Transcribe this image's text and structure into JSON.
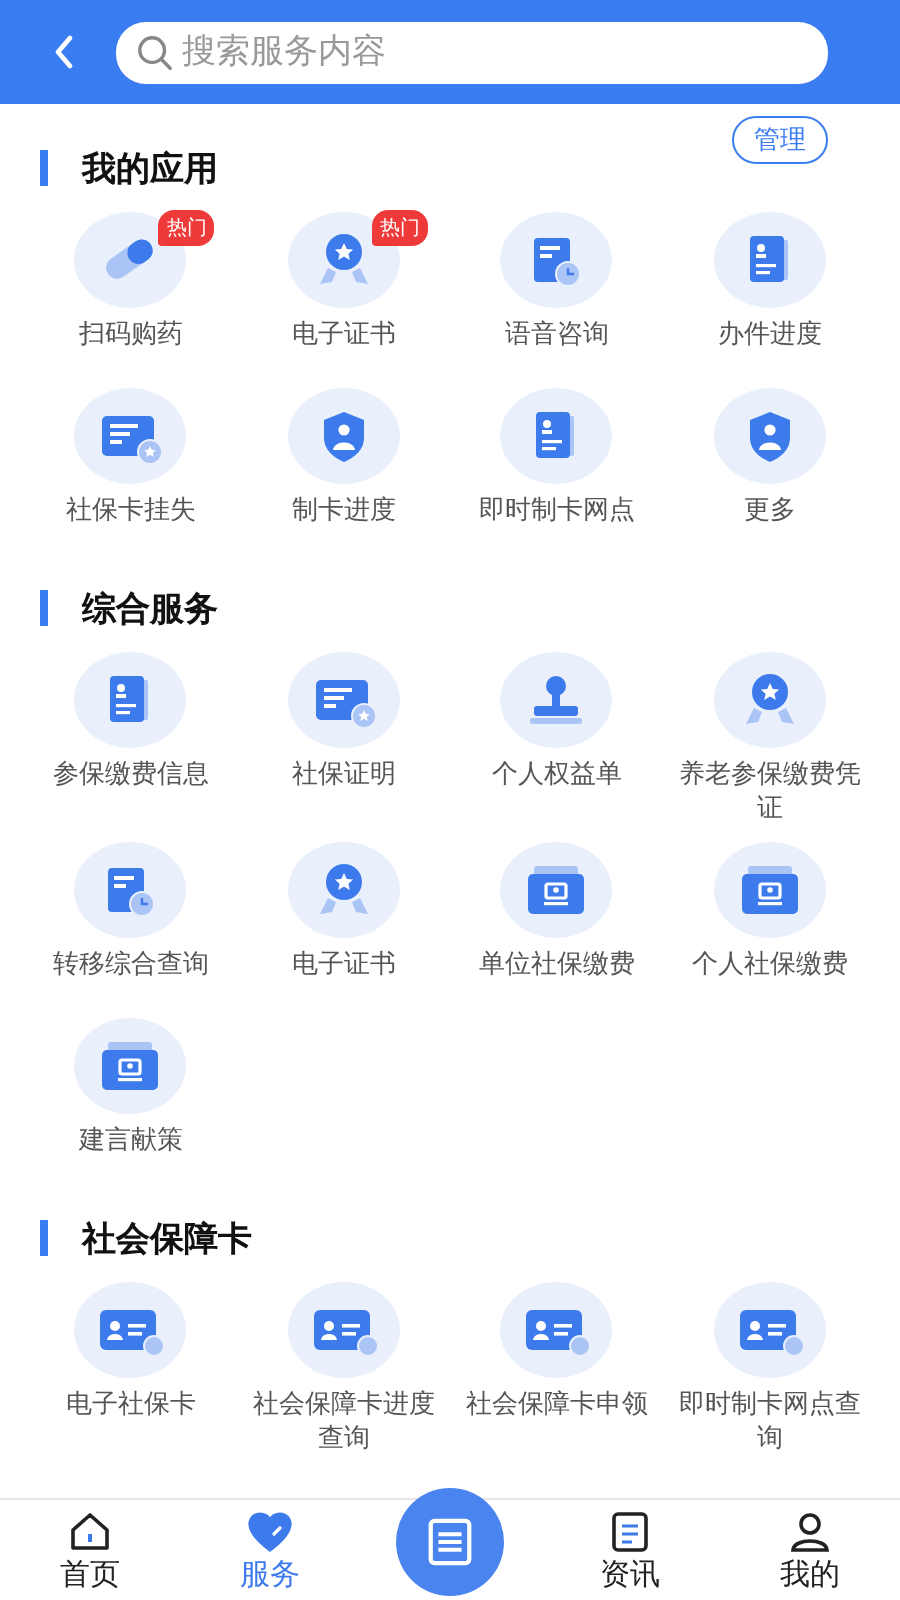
{
  "header": {
    "search": {
      "placeholder": "搜索服务内容"
    }
  },
  "sections": [
    {
      "title": "我的应用",
      "action": "管理",
      "items": [
        {
          "label": "扫码购药",
          "kind": "pill",
          "badge": "热门"
        },
        {
          "label": "电子证书",
          "kind": "medal",
          "badge": "热门"
        },
        {
          "label": "语音咨询",
          "kind": "doc-clock"
        },
        {
          "label": "办件进度",
          "kind": "id-doc"
        },
        {
          "label": "社保卡挂失",
          "kind": "card-star"
        },
        {
          "label": "制卡进度",
          "kind": "shield"
        },
        {
          "label": "即时制卡网点",
          "kind": "id-doc"
        },
        {
          "label": "更多",
          "kind": "shield"
        }
      ]
    },
    {
      "title": "综合服务",
      "items": [
        {
          "label": "参保缴费信息",
          "kind": "id-doc"
        },
        {
          "label": "社保证明",
          "kind": "card-star"
        },
        {
          "label": "个人权益单",
          "kind": "stamp"
        },
        {
          "label": "养老参保缴费凭证",
          "kind": "medal"
        },
        {
          "label": "转移综合查询",
          "kind": "doc-clock"
        },
        {
          "label": "电子证书",
          "kind": "medal"
        },
        {
          "label": "单位社保缴费",
          "kind": "wallet"
        },
        {
          "label": "个人社保缴费",
          "kind": "wallet"
        },
        {
          "label": "建言献策",
          "kind": "wallet"
        }
      ]
    },
    {
      "title": "社会保障卡",
      "items": [
        {
          "label": "电子社保卡",
          "kind": "card"
        },
        {
          "label": "社会保障卡进度查询",
          "kind": "card"
        },
        {
          "label": "社会保障卡申领",
          "kind": "card"
        },
        {
          "label": "即时制卡网点查询",
          "kind": "card"
        }
      ]
    }
  ],
  "tabbar": [
    {
      "kind": "home",
      "label": "首页",
      "selected": false
    },
    {
      "kind": "heart",
      "label": "服务",
      "selected": true
    },
    {
      "kind": "scan",
      "selected": false
    },
    {
      "kind": "news",
      "label": "资讯",
      "selected": false
    },
    {
      "kind": "user",
      "label": "我的",
      "selected": false
    }
  ]
}
